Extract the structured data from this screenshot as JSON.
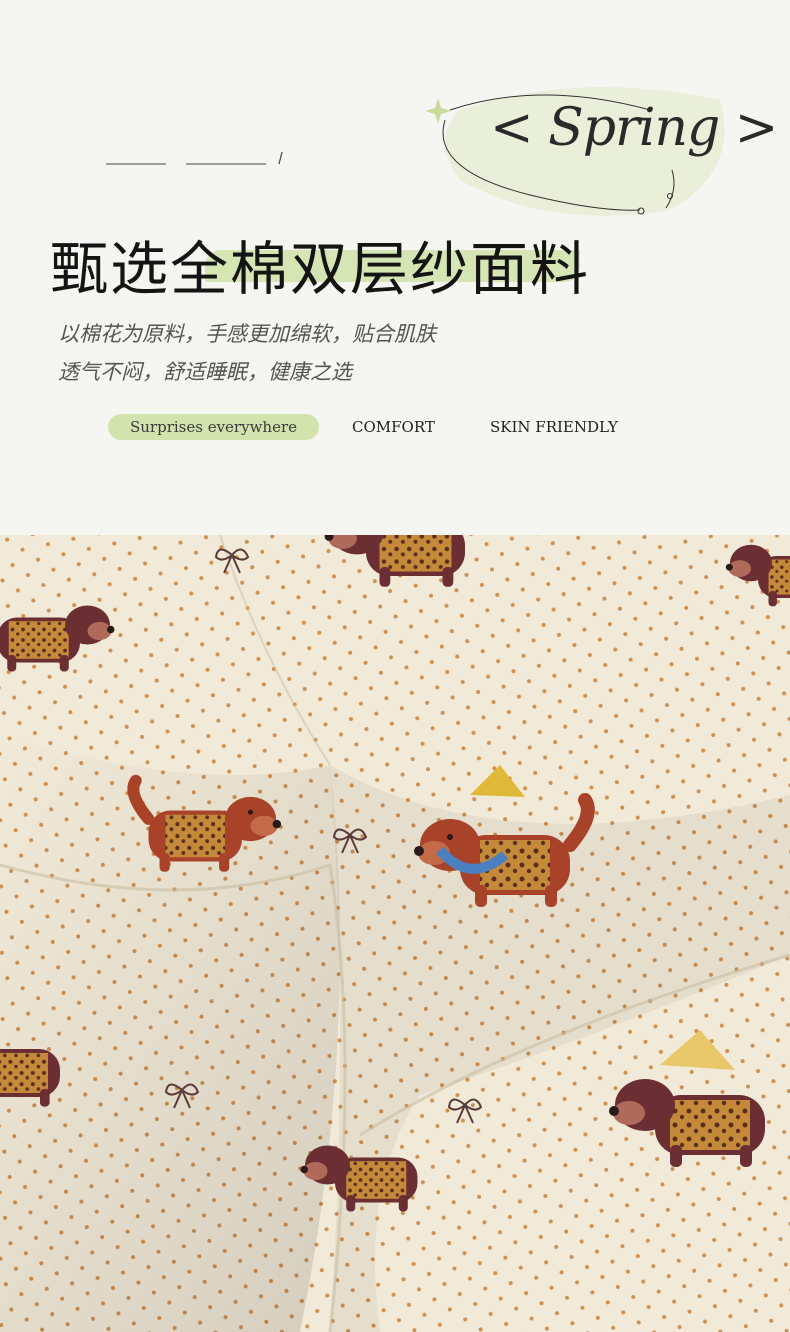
{
  "hero": {
    "spring_word": "< Spring >",
    "headline": "甄选全棉双层纱面料",
    "description_lines": [
      "以棉花为原料，手感更加绵软，贴合肌肤",
      "透气不闷，舒适睡眠，健康之选"
    ],
    "tags": [
      "Surprises everywhere",
      "COMFORT",
      "SKIN FRIENDLY"
    ]
  },
  "colors": {
    "background": "#f5f5f1",
    "accent_green": "#d3e3ad",
    "text_dark": "#141414",
    "fabric_cream": "#f2ead8",
    "dot_orange": "#d09050",
    "dog_brown": "#a8432a",
    "dog_dark": "#6b2f33",
    "leopard": "#c48a3a",
    "hat_yellow": "#e0b83a",
    "collar_blue": "#4a7fc0"
  },
  "photo": {
    "subject": "dog-print-gauze-fabric-photo"
  }
}
